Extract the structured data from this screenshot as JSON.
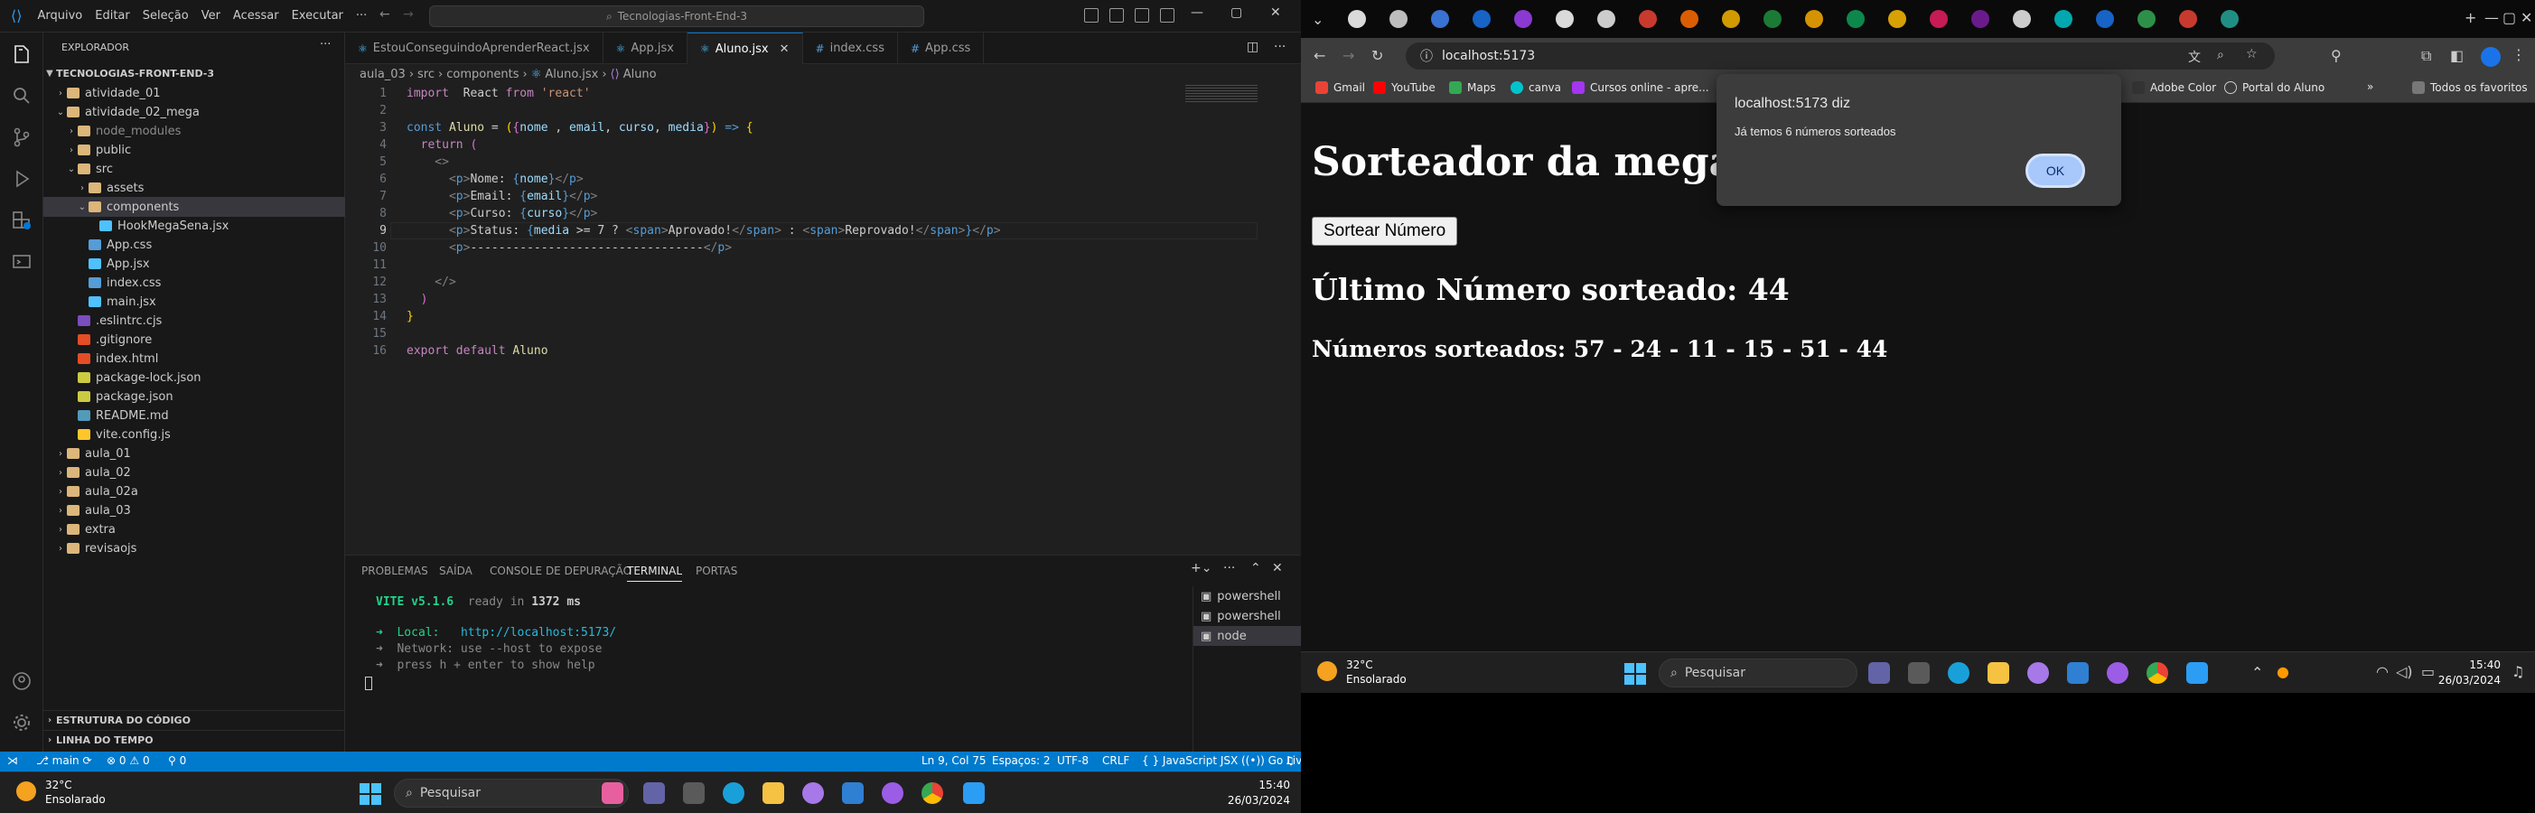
{
  "vscode": {
    "menu": [
      "Arquivo",
      "Editar",
      "Seleção",
      "Ver",
      "Acessar",
      "Executar",
      "···"
    ],
    "command_center": "Tecnologias-Front-End-3",
    "explorer_title": "EXPLORADOR",
    "workspace_root": "TECNOLOGIAS-FRONT-END-3",
    "tree": [
      {
        "label": "atividade_01",
        "type": "folder",
        "depth": 1,
        "open": false
      },
      {
        "label": "atividade_02_mega",
        "type": "folder",
        "depth": 1,
        "open": true
      },
      {
        "label": "node_modules",
        "type": "folder",
        "depth": 2,
        "open": false
      },
      {
        "label": "public",
        "type": "folder",
        "depth": 2,
        "open": false
      },
      {
        "label": "src",
        "type": "folder",
        "depth": 2,
        "open": true
      },
      {
        "label": "assets",
        "type": "folder",
        "depth": 3,
        "open": false
      },
      {
        "label": "components",
        "type": "folder",
        "depth": 3,
        "open": true,
        "selected": true
      },
      {
        "label": "HookMegaSena.jsx",
        "type": "jsx",
        "depth": 4
      },
      {
        "label": "App.css",
        "type": "css",
        "depth": 3
      },
      {
        "label": "App.jsx",
        "type": "jsx",
        "depth": 3
      },
      {
        "label": "index.css",
        "type": "css",
        "depth": 3
      },
      {
        "label": "main.jsx",
        "type": "jsx",
        "depth": 3
      },
      {
        "label": ".eslintrc.cjs",
        "type": "eslint",
        "depth": 2
      },
      {
        "label": ".gitignore",
        "type": "git",
        "depth": 2
      },
      {
        "label": "index.html",
        "type": "html",
        "depth": 2
      },
      {
        "label": "package-lock.json",
        "type": "json",
        "depth": 2
      },
      {
        "label": "package.json",
        "type": "json",
        "depth": 2
      },
      {
        "label": "README.md",
        "type": "md",
        "depth": 2
      },
      {
        "label": "vite.config.js",
        "type": "vite",
        "depth": 2
      },
      {
        "label": "aula_01",
        "type": "folder",
        "depth": 1,
        "open": false
      },
      {
        "label": "aula_02",
        "type": "folder",
        "depth": 1,
        "open": false
      },
      {
        "label": "aula_02a",
        "type": "folder",
        "depth": 1,
        "open": false
      },
      {
        "label": "aula_03",
        "type": "folder",
        "depth": 1,
        "open": false
      },
      {
        "label": "extra",
        "type": "folder",
        "depth": 1,
        "open": false
      },
      {
        "label": "revisaojs",
        "type": "folder",
        "depth": 1,
        "open": false
      }
    ],
    "outline": "ESTRUTURA DO CÓDIGO",
    "timeline": "LINHA DO TEMPO",
    "tabs": [
      "EstouConseguindoAprenderReact.jsx",
      "App.jsx",
      "Aluno.jsx",
      "index.css",
      "App.css"
    ],
    "active_tab": "Aluno.jsx",
    "breadcrumb": [
      "aula_03",
      "src",
      "components",
      "Aluno.jsx",
      "Aluno"
    ],
    "line_numbers": [
      "1",
      "2",
      "3",
      "4",
      "5",
      "6",
      "7",
      "8",
      "9",
      "10",
      "11",
      "12",
      "13",
      "14",
      "15",
      "16"
    ],
    "panel_tabs": [
      "PROBLEMAS",
      "SAÍDA",
      "CONSOLE DE DEPURAÇÃO",
      "TERMINAL",
      "PORTAS"
    ],
    "active_panel_tab": "TERMINAL",
    "terminal": {
      "vite": "VITE v5.1.6",
      "ready": "ready in",
      "ms": "1372 ms",
      "local_label": "➜  Local:",
      "local_url": "http://localhost:5173/",
      "network": "➜  Network: use --host to expose",
      "help": "➜  press h + enter to show help"
    },
    "terminals": [
      "powershell",
      "powershell",
      "node"
    ],
    "status": {
      "branch": "main",
      "errors": "0",
      "warnings": "0",
      "ports": "0",
      "position": "Ln 9, Col 75",
      "spaces": "Espaços: 2",
      "encoding": "UTF-8",
      "eol": "CRLF",
      "language": "JavaScript JSX",
      "golive": "Go Live"
    }
  },
  "code_lines": [
    [
      [
        "k",
        "import"
      ],
      [
        "",
        "  React "
      ],
      [
        "k",
        "from"
      ],
      [
        "s",
        " 'react'"
      ]
    ],
    [],
    [
      [
        "t",
        "const"
      ],
      [
        "f",
        " Aluno"
      ],
      [
        "",
        " = "
      ],
      [
        "p",
        "("
      ],
      [
        "b",
        "{"
      ],
      [
        "v",
        "nome"
      ],
      [
        "",
        " , "
      ],
      [
        "v",
        "email"
      ],
      [
        "",
        ", "
      ],
      [
        "v",
        "curso"
      ],
      [
        "",
        ", "
      ],
      [
        "v",
        "media"
      ],
      [
        "b",
        "}"
      ],
      [
        "p",
        ")"
      ],
      [
        "t",
        " =>"
      ],
      [
        "p",
        " {"
      ]
    ],
    [
      [
        "k",
        "  return"
      ],
      [
        "b",
        " ("
      ]
    ],
    [
      [
        "g",
        "    <>"
      ]
    ],
    [
      [
        "g",
        "      <"
      ],
      [
        "t",
        "p"
      ],
      [
        "g",
        ">"
      ],
      [
        "",
        "Nome: "
      ],
      [
        "t",
        "{"
      ],
      [
        "v",
        "nome"
      ],
      [
        "t",
        "}"
      ],
      [
        "g",
        "</"
      ],
      [
        "t",
        "p"
      ],
      [
        "g",
        ">"
      ]
    ],
    [
      [
        "g",
        "      <"
      ],
      [
        "t",
        "p"
      ],
      [
        "g",
        ">"
      ],
      [
        "",
        "Email: "
      ],
      [
        "t",
        "{"
      ],
      [
        "v",
        "email"
      ],
      [
        "t",
        "}"
      ],
      [
        "g",
        "</"
      ],
      [
        "t",
        "p"
      ],
      [
        "g",
        ">"
      ]
    ],
    [
      [
        "g",
        "      <"
      ],
      [
        "t",
        "p"
      ],
      [
        "g",
        ">"
      ],
      [
        "",
        "Curso: "
      ],
      [
        "t",
        "{"
      ],
      [
        "v",
        "curso"
      ],
      [
        "t",
        "}"
      ],
      [
        "g",
        "</"
      ],
      [
        "t",
        "p"
      ],
      [
        "g",
        ">"
      ]
    ],
    [
      [
        "g",
        "      <"
      ],
      [
        "t",
        "p"
      ],
      [
        "g",
        ">"
      ],
      [
        "",
        "Status: "
      ],
      [
        "t",
        "{"
      ],
      [
        "v",
        "media"
      ],
      [
        "",
        " >= 7 ? "
      ],
      [
        "g",
        "<"
      ],
      [
        "t",
        "span"
      ],
      [
        "g",
        ">"
      ],
      [
        "",
        "Aprovado!"
      ],
      [
        "g",
        "</"
      ],
      [
        "t",
        "span"
      ],
      [
        "g",
        ">"
      ],
      [
        "",
        " : "
      ],
      [
        "g",
        "<"
      ],
      [
        "t",
        "span"
      ],
      [
        "g",
        ">"
      ],
      [
        "",
        "Reprovado!"
      ],
      [
        "g",
        "</"
      ],
      [
        "t",
        "span"
      ],
      [
        "g",
        ">"
      ],
      [
        "t",
        "}"
      ],
      [
        "g",
        "</"
      ],
      [
        "t",
        "p"
      ],
      [
        "g",
        ">"
      ]
    ],
    [
      [
        "g",
        "      <"
      ],
      [
        "t",
        "p"
      ],
      [
        "g",
        ">"
      ],
      [
        "",
        "---------------------------------"
      ],
      [
        "g",
        "</"
      ],
      [
        "t",
        "p"
      ],
      [
        "g",
        ">"
      ]
    ],
    [],
    [
      [
        "g",
        "    </>"
      ]
    ],
    [
      [
        "b",
        "  )"
      ]
    ],
    [
      [
        "p",
        "}"
      ]
    ],
    [],
    [
      [
        "k",
        "export default"
      ],
      [
        "f",
        " Aluno"
      ]
    ]
  ],
  "chrome": {
    "url": "localhost:5173",
    "bookmarks": [
      "Gmail",
      "YouTube",
      "Maps",
      "canva",
      "Cursos online - apre...",
      "Adobe Color",
      "Portal do Aluno",
      "Todos os favoritos"
    ],
    "page": {
      "title": "Sorteador da mega en",
      "button": "Sortear Número",
      "last": "Último Número sorteado: 44",
      "all": "Números sorteados: 57 - 24 - 11 - 15 - 51 - 44"
    },
    "dialog": {
      "title": "localhost:5173 diz",
      "message": "Já temos 6 números sorteados",
      "ok": "OK"
    }
  },
  "taskbar": {
    "temp": "32°C",
    "weather": "Ensolarado",
    "search": "Pesquisar",
    "time": "15:40",
    "date": "26/03/2024"
  },
  "colors": {
    "accent": "#007acc",
    "folder": "#dcb67a",
    "jsx": "#4fc1ff",
    "css": "#569cd6",
    "dialog_ok": "#a8c7fa"
  }
}
